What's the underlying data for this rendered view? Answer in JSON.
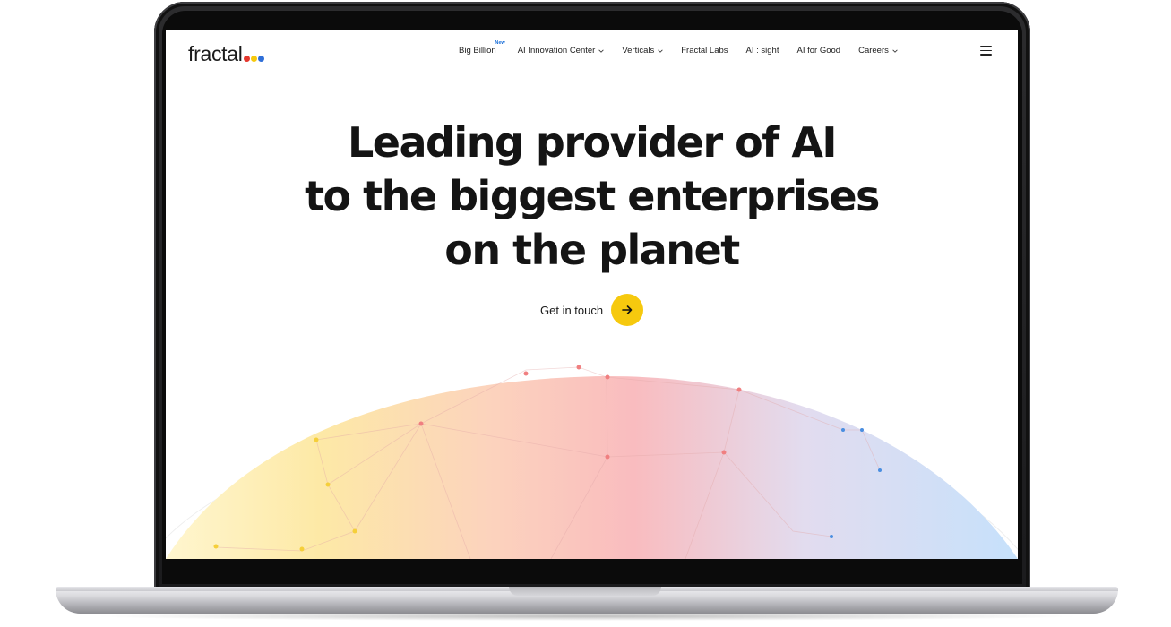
{
  "brand": {
    "logo_text": "fractal",
    "logo_dot_colors": [
      "#e5372d",
      "#f6c90e",
      "#2f6fd8"
    ]
  },
  "nav": {
    "items": [
      {
        "label": "Big Billion",
        "badge": "New",
        "has_dropdown": false
      },
      {
        "label": "AI Innovation Center",
        "has_dropdown": true
      },
      {
        "label": "Verticals",
        "has_dropdown": true
      },
      {
        "label": "Fractal Labs",
        "has_dropdown": false
      },
      {
        "label": "AI : sight",
        "has_dropdown": false
      },
      {
        "label": "AI for Good",
        "has_dropdown": false
      },
      {
        "label": "Careers",
        "has_dropdown": true
      }
    ],
    "menu_icon": "hamburger-icon"
  },
  "hero": {
    "lines": [
      "Leading provider of AI",
      "to the biggest enterprises",
      "on the planet"
    ]
  },
  "cta": {
    "label": "Get in touch",
    "icon": "arrow-right-icon",
    "color": "#f6c90e"
  },
  "globe": {
    "gradient_colors": [
      "#fde7a0",
      "#fcc7b6",
      "#f9b5b8",
      "#d9dcf2",
      "#c9e2fb"
    ]
  }
}
